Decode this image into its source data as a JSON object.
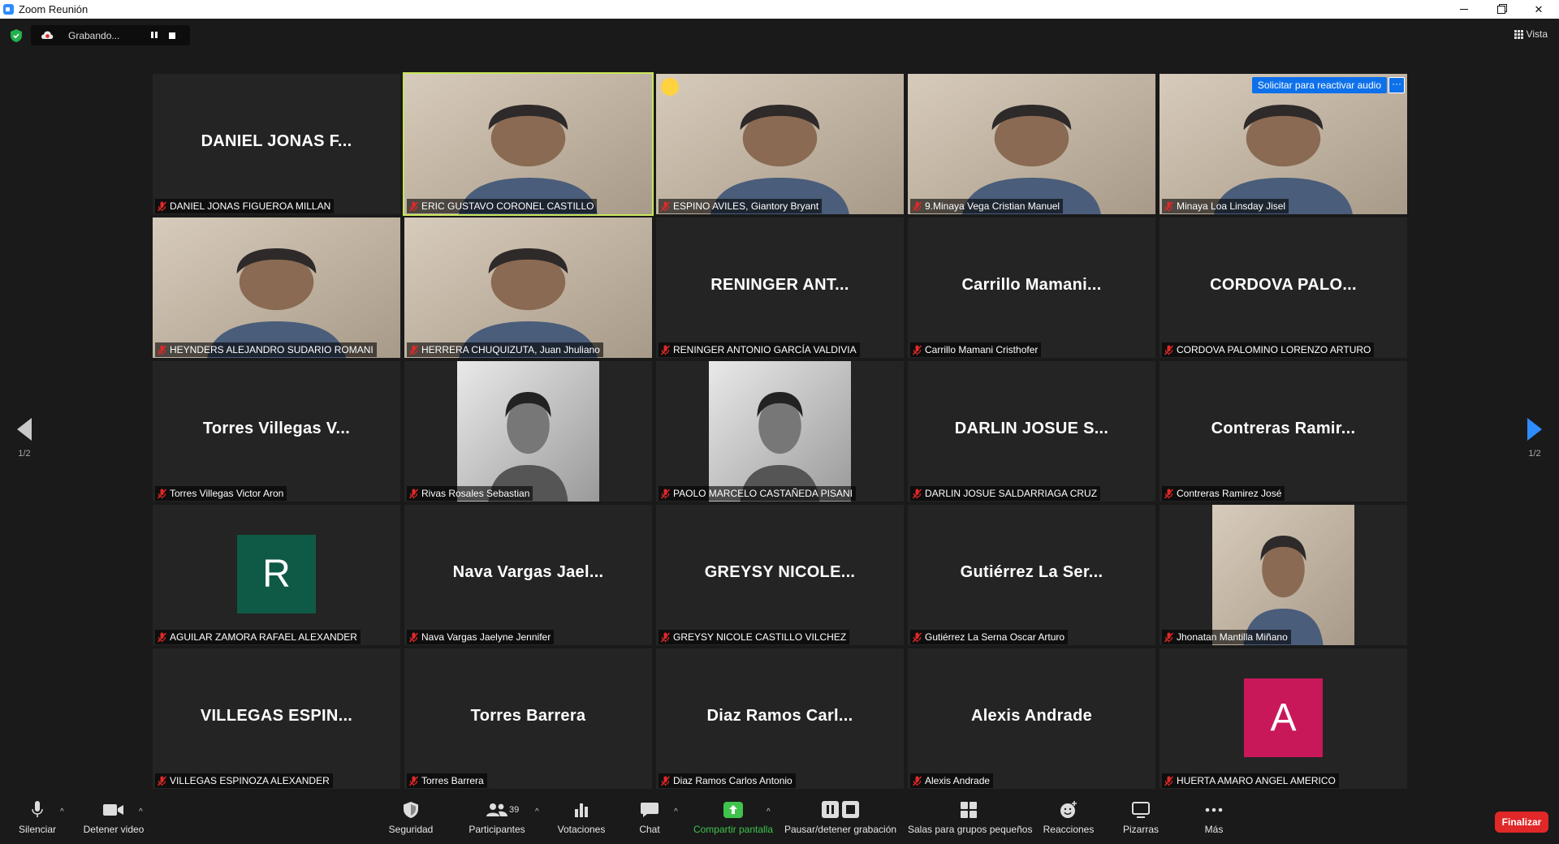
{
  "window": {
    "title": "Zoom Reunión"
  },
  "topbar": {
    "recording_label": "Grabando...",
    "view_label": "Vista"
  },
  "pagination": {
    "left": "1/2",
    "right": "1/2"
  },
  "participants": [
    {
      "display": "DANIEL JONAS F...",
      "name": "DANIEL JONAS FIGUEROA MILLAN",
      "video": false
    },
    {
      "display": "",
      "name": "ERIC GUSTAVO CORONEL CASTILLO",
      "video": true,
      "active": true
    },
    {
      "display": "",
      "name": "ESPINO AVILES, Giantory Bryant",
      "video": true,
      "emoji": true
    },
    {
      "display": "",
      "name": "9.Minaya Vega Cristian Manuel",
      "video": true
    },
    {
      "display": "",
      "name": "Minaya Loa Linsday Jisel",
      "video": true,
      "action": "Solicitar para reactivar audio",
      "more": "···"
    },
    {
      "display": "",
      "name": "HEYNDERS ALEJANDRO SUDARIO ROMANI",
      "video": true
    },
    {
      "display": "",
      "name": "HERRERA CHUQUIZUTA, Juan Jhuliano",
      "video": true
    },
    {
      "display": "RENINGER ANT...",
      "name": "RENINGER ANTONIO GARCÍA VALDIVIA",
      "video": false
    },
    {
      "display": "Carrillo Mamani...",
      "name": "Carrillo Mamani Cristhofer",
      "video": false
    },
    {
      "display": "CORDOVA PALO...",
      "name": "CORDOVA PALOMINO LORENZO ARTURO",
      "video": false
    },
    {
      "display": "Torres Villegas V...",
      "name": "Torres Villegas Victor Aron",
      "video": false
    },
    {
      "display": "",
      "name": "Rivas Rosales Sebastian",
      "video": true,
      "narrow": true,
      "bw": true
    },
    {
      "display": "",
      "name": "PAOLO MARCELO CASTAÑEDA PISANI",
      "video": true,
      "narrow": true,
      "bw": true
    },
    {
      "display": "DARLIN JOSUE S...",
      "name": "DARLIN JOSUE SALDARRIAGA CRUZ",
      "video": false
    },
    {
      "display": "Contreras Ramir...",
      "name": "Contreras Ramirez José",
      "video": false
    },
    {
      "display": "",
      "name": "AGUILAR ZAMORA RAFAEL ALEXANDER",
      "video": false,
      "avatar": "R",
      "avatar_color": "#0f5a47"
    },
    {
      "display": "Nava Vargas Jael...",
      "name": "Nava Vargas Jaelyne Jennifer",
      "video": false
    },
    {
      "display": "GREYSY NICOLE...",
      "name": "GREYSY NICOLE CASTILLO VILCHEZ",
      "video": false
    },
    {
      "display": "Gutiérrez La Ser...",
      "name": "Gutiérrez La Serna Oscar Arturo",
      "video": false
    },
    {
      "display": "",
      "name": "Jhonatan Mantilla Miñano",
      "video": true,
      "narrow": true
    },
    {
      "display": "VILLEGAS ESPIN...",
      "name": "VILLEGAS ESPINOZA ALEXANDER",
      "video": false
    },
    {
      "display": "Torres Barrera",
      "name": "Torres Barrera",
      "video": false
    },
    {
      "display": "Diaz Ramos Carl...",
      "name": "Diaz Ramos Carlos Antonio",
      "video": false
    },
    {
      "display": "Alexis Andrade",
      "name": "Alexis Andrade",
      "video": false
    },
    {
      "display": "",
      "name": "HUERTA AMARO ANGEL AMERICO",
      "video": false,
      "avatar": "A",
      "avatar_color": "#c8185a"
    }
  ],
  "toolbar": {
    "mute": "Silenciar",
    "stop_video": "Detener video",
    "security": "Seguridad",
    "participants": "Participantes",
    "participants_count": "39",
    "polls": "Votaciones",
    "chat": "Chat",
    "share": "Compartir pantalla",
    "record": "Pausar/detener grabación",
    "breakout": "Salas para grupos pequeños",
    "reactions": "Reacciones",
    "whiteboards": "Pizarras",
    "more": "Más",
    "end": "Finalizar"
  },
  "colors": {
    "accent": "#2D8CFF",
    "active_speaker": "#c8e65a",
    "end": "#e02828",
    "share": "#3fc34c",
    "mute_red": "#e02828"
  }
}
